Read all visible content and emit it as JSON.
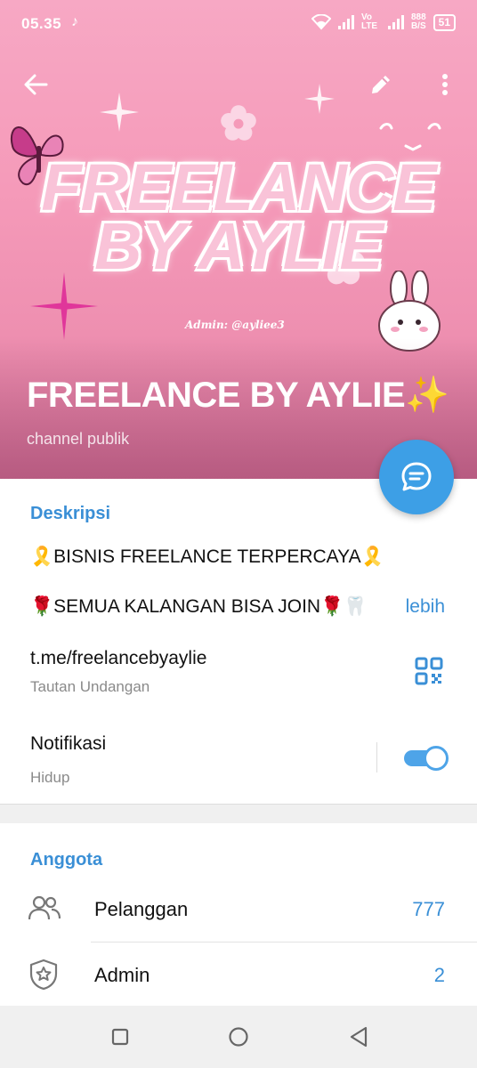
{
  "status_bar": {
    "time": "05.35",
    "network": "Vo LTE",
    "speed_top": "888",
    "speed_bottom": "B/S",
    "battery": "51"
  },
  "header": {
    "banner_line1": "FREELANCE",
    "banner_line2": "BY AYLIE",
    "banner_admin": "Admin: @ayliee3",
    "title": "FREELANCE BY AYLIE✨",
    "subtitle": "channel publik",
    "bg_color": "#f59ab9"
  },
  "info": {
    "description_title": "Deskripsi",
    "description_line1": "🎗️BISNIS FREELANCE TERPERCAYA🎗️",
    "description_line2": "🌹SEMUA KALANGAN BISA JOIN🌹🦷",
    "more_label": "lebih",
    "link": "t.me/freelancebyaylie",
    "link_caption": "Tautan Undangan",
    "notifications_label": "Notifikasi",
    "notifications_value": "Hidup",
    "notifications_on": true
  },
  "members": {
    "title": "Anggota",
    "rows": [
      {
        "label": "Pelanggan",
        "count": "777",
        "icon": "users-icon"
      },
      {
        "label": "Admin",
        "count": "2",
        "icon": "shield-star-icon"
      }
    ]
  },
  "accent_color": "#3a8fd6"
}
